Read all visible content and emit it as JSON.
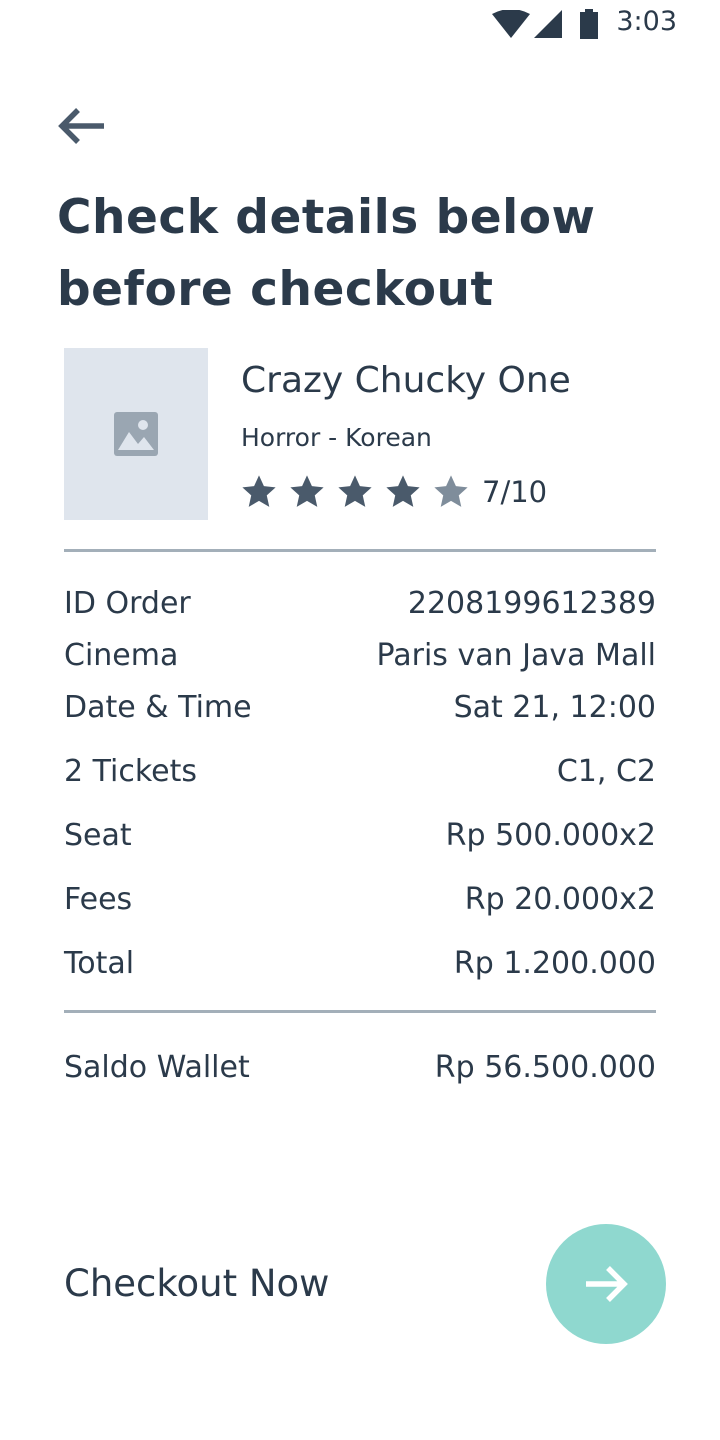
{
  "status_bar": {
    "time": "3:03"
  },
  "header": {
    "title": "Check details below before checkout"
  },
  "movie": {
    "title": "Crazy Chucky One",
    "genre": "Horror - Korean",
    "rating_text": "7/10",
    "stars_filled": 4,
    "stars_total": 5
  },
  "details": [
    {
      "label": "ID Order",
      "value": "22081996123​89"
    },
    {
      "label": "Cinema",
      "value": "Paris van Java Mall"
    },
    {
      "label": "Date & Time",
      "value": "Sat 21, 12:00"
    },
    {
      "label": "2 Tickets",
      "value": "C1, C2"
    },
    {
      "label": "Seat",
      "value": "Rp 500.000x2"
    },
    {
      "label": "Fees",
      "value": "Rp 20.000x2"
    },
    {
      "label": "Total",
      "value": "Rp 1.200.000"
    }
  ],
  "wallet": {
    "label": "Saldo Wallet",
    "value": "Rp 56.500.000"
  },
  "footer": {
    "checkout_label": "Checkout Now"
  },
  "colors": {
    "text": "#2b3a4a",
    "placeholder_bg": "#dfe5ed",
    "divider": "#a3afb9",
    "fab": "#8fd8cf",
    "star_filled": "#4a5a6b",
    "star_empty": "#7f8d9b"
  },
  "icons": {
    "back": "arrow-left-icon",
    "thumbnail": "image-placeholder-icon",
    "star": "star-icon",
    "fab": "arrow-right-icon"
  }
}
